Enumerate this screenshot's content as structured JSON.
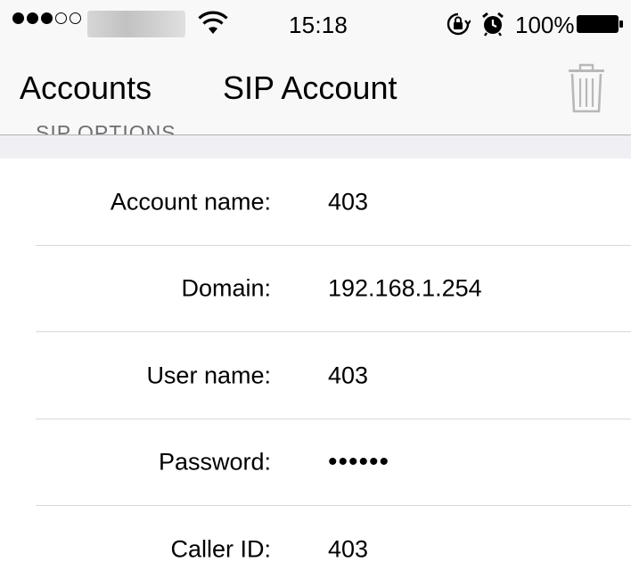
{
  "status_bar": {
    "signal": "signal-dots",
    "time": "15:18",
    "battery_percent": "100%",
    "icons": [
      "wifi-icon",
      "rotation-lock-icon",
      "alarm-icon",
      "battery-icon"
    ]
  },
  "nav": {
    "back_label": "Accounts",
    "title": "SIP Account",
    "right_icon": "trash-icon",
    "section_header": "SIP OPTIONS"
  },
  "form": {
    "rows": [
      {
        "label": "Account name:",
        "value": "403"
      },
      {
        "label": "Domain:",
        "value": "192.168.1.254"
      },
      {
        "label": "User name:",
        "value": "403"
      },
      {
        "label": "Password:",
        "value": "••••••"
      },
      {
        "label": "Caller ID:",
        "value": "403"
      }
    ]
  },
  "colors": {
    "bar_background": "#f8f8f8",
    "section_background": "#efeff4",
    "separator": "#d8d8dc",
    "text": "#000000"
  }
}
